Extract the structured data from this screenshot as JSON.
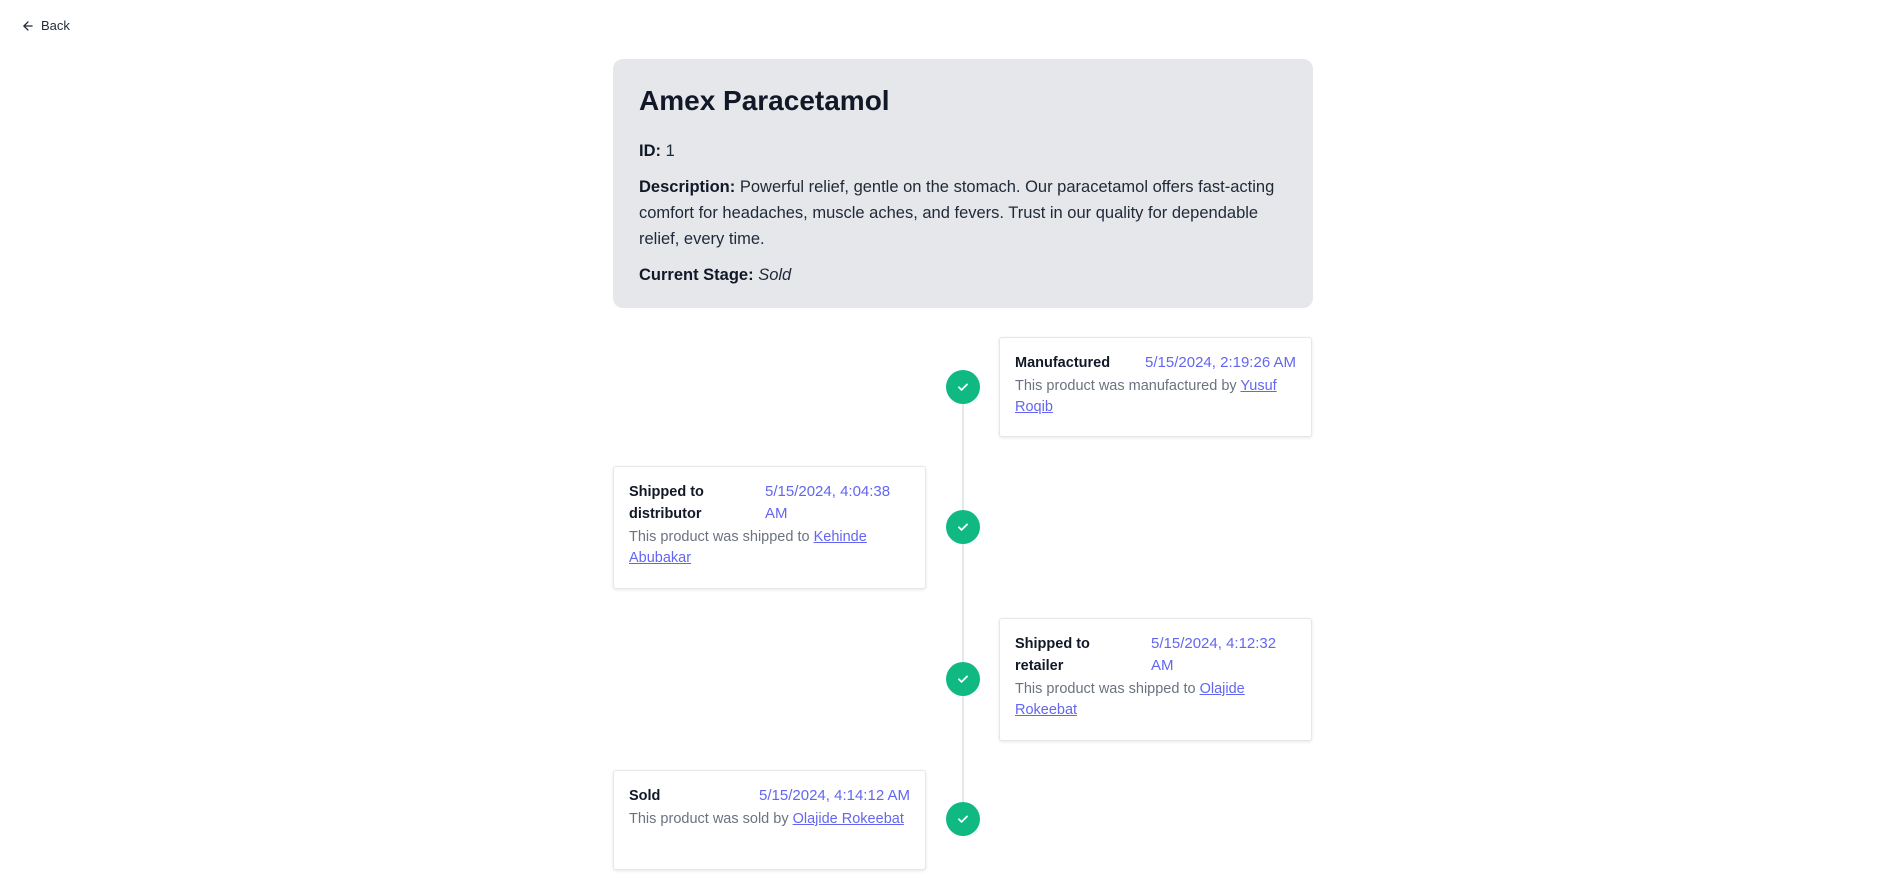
{
  "nav": {
    "back_label": "Back"
  },
  "product": {
    "name": "Amex Paracetamol",
    "id_label": "ID:",
    "id_value": "1",
    "description_label": "Description:",
    "description": "Powerful relief, gentle on the stomach. Our paracetamol offers fast-acting comfort for headaches, muscle aches, and fevers. Trust in our quality for dependable relief, every time.",
    "stage_label": "Current Stage:",
    "stage_value": "Sold"
  },
  "timeline": {
    "status_color": "#10b981",
    "accent_color": "#6366f1",
    "events": [
      {
        "title": "Manufactured",
        "date": "5/15/2024, 2:19:26 AM",
        "desc": "This product was manufactured by",
        "person": "Yusuf Roqib",
        "icon": "check-icon"
      },
      {
        "title": "Shipped to distributor",
        "date": "5/15/2024, 4:04:38 AM",
        "desc": "This product was shipped to",
        "person": "Kehinde Abubakar",
        "icon": "check-icon"
      },
      {
        "title": "Shipped to retailer",
        "date": "5/15/2024, 4:12:32 AM",
        "desc": "This product was shipped to",
        "person": "Olajide Rokeebat",
        "icon": "check-icon"
      },
      {
        "title": "Sold",
        "date": "5/15/2024, 4:14:12 AM",
        "desc": "This product was sold by",
        "person": "Olajide Rokeebat",
        "icon": "check-icon"
      }
    ]
  }
}
